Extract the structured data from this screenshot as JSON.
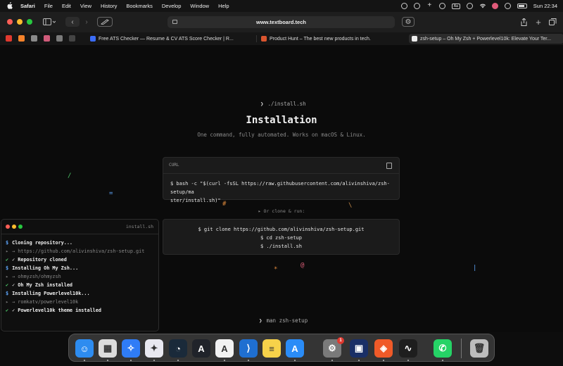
{
  "menubar": {
    "app": "Safari",
    "items": [
      "File",
      "Edit",
      "View",
      "History",
      "Bookmarks",
      "Develop",
      "Window",
      "Help"
    ],
    "clock": "Sun 22:34"
  },
  "toolbar": {
    "url": "www.textboard.tech"
  },
  "tabs": [
    {
      "title": "Free ATS Checker — Resume & CV ATS Score Checker | R...",
      "color": "#3b6cf6"
    },
    {
      "title": "Product Hunt – The best new products in tech.",
      "color": "#da552f"
    },
    {
      "title": "zsh-setup – Oh My Zsh + Powerlevel10k: Elevate Your Ter...",
      "color": "#eeeeee"
    }
  ],
  "pinned_colors": [
    "#e0392f",
    "#f5822a",
    "#8a8a8a",
    "#d05b7a",
    "#7a7a7a",
    "#444444"
  ],
  "page": {
    "top_command": "./install.sh",
    "title": "Installation",
    "subtitle": "One command, fully automated. Works on macOS & Linux.",
    "curl_card": {
      "label": "CURL",
      "code_line1": "$ bash -c \"$(curl -fsSL https://raw.githubusercontent.com/alivinshiva/zsh-setup/ma",
      "code_line2": "ster/install.sh)\""
    },
    "clone_label": "▸ Or clone & run:",
    "clone_lines": [
      "$ git clone https://github.com/alivinshiva/zsh-setup.git",
      "$ cd zsh-setup",
      "$ ./install.sh"
    ],
    "bottom_command": "man zsh-setup",
    "decorations": [
      "/",
      "=",
      "#",
      "\\",
      "*",
      "@",
      "|"
    ]
  },
  "terminal": {
    "title": "install.sh",
    "lines": [
      {
        "prefix": "$",
        "kind": "cmd",
        "text": "Cloning repository..."
      },
      {
        "prefix": "▸",
        "kind": "info",
        "text": "→ https://github.com/alivinshiva/zsh-setup.git"
      },
      {
        "prefix": "✔",
        "kind": "ok",
        "text": "✓ Repository cloned"
      },
      {
        "prefix": "$",
        "kind": "cmd",
        "text": "Installing Oh My Zsh..."
      },
      {
        "prefix": "▸",
        "kind": "info",
        "text": "→ ohmyzsh/ohmyzsh"
      },
      {
        "prefix": "✔",
        "kind": "ok",
        "text": "✓ Oh My Zsh installed"
      },
      {
        "prefix": "$",
        "kind": "cmd",
        "text": "Installing Powerlevel10k..."
      },
      {
        "prefix": "▸",
        "kind": "info",
        "text": "→ romkatv/powerlevel10k"
      },
      {
        "prefix": "✔",
        "kind": "ok",
        "text": "✓ Powerlevel10k theme installed"
      }
    ]
  },
  "dock": {
    "apps": [
      {
        "name": "Finder",
        "color": "#2d8cf0",
        "glyph": "☺"
      },
      {
        "name": "Launchpad",
        "color": "#dcdcdc",
        "glyph": "▦"
      },
      {
        "name": "Safari",
        "color": "#2f7cf6",
        "glyph": "✧"
      },
      {
        "name": "Chat",
        "color": "#e8e8f0",
        "glyph": "✦"
      },
      {
        "name": "Wireless",
        "color": "#1a2a3a",
        "glyph": "◔"
      },
      {
        "name": "Arc",
        "color": "#20232a",
        "glyph": "A"
      },
      {
        "name": "Arc Alt",
        "color": "#f2f2f2",
        "glyph": "A"
      },
      {
        "name": "VS Code",
        "color": "#1f6fd1",
        "glyph": "⟩"
      },
      {
        "name": "Notes",
        "color": "#f7d24a",
        "glyph": "≡"
      },
      {
        "name": "App Store",
        "color": "#2a8cf7",
        "glyph": "A"
      },
      {
        "name": "System Settings",
        "color": "#7a7a7a",
        "glyph": "⚙"
      },
      {
        "name": "Screen",
        "color": "#1a2f66",
        "glyph": "▣"
      },
      {
        "name": "Brave",
        "color": "#f05a28",
        "glyph": "◈"
      },
      {
        "name": "Activity Monitor",
        "color": "#1e1e1e",
        "glyph": "∿"
      },
      {
        "name": "WhatsApp",
        "color": "#25d366",
        "glyph": "✆"
      },
      {
        "name": "Trash",
        "color": "#bdbdbd",
        "glyph": "🗑"
      }
    ],
    "settings_badge": "1"
  }
}
